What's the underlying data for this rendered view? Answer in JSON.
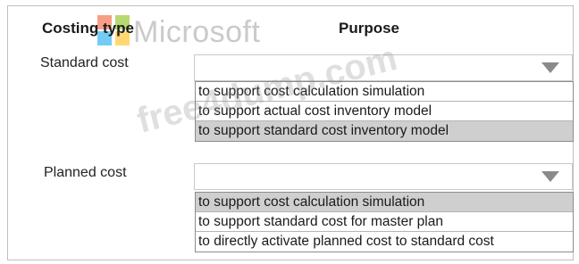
{
  "headers": {
    "costing_type": "Costing type",
    "purpose": "Purpose"
  },
  "rows": [
    {
      "label": "Standard cost",
      "dropdown_value": "",
      "options": [
        "to support cost calculation simulation",
        "to support actual cost inventory model",
        "to support standard cost inventory model"
      ],
      "selected_index": 2
    },
    {
      "label": "Planned cost",
      "dropdown_value": "",
      "options": [
        "to support cost calculation simulation",
        "to support standard cost for master plan",
        "to directly activate planned cost to standard cost"
      ],
      "selected_index": 0
    }
  ],
  "logo": {
    "word": "Microsoft",
    "colors": [
      "#f25022",
      "#7fba00",
      "#00a4ef",
      "#ffb900"
    ]
  },
  "watermark": "free4dump.com",
  "icons": {
    "dropdown": "chevron-down-icon"
  }
}
